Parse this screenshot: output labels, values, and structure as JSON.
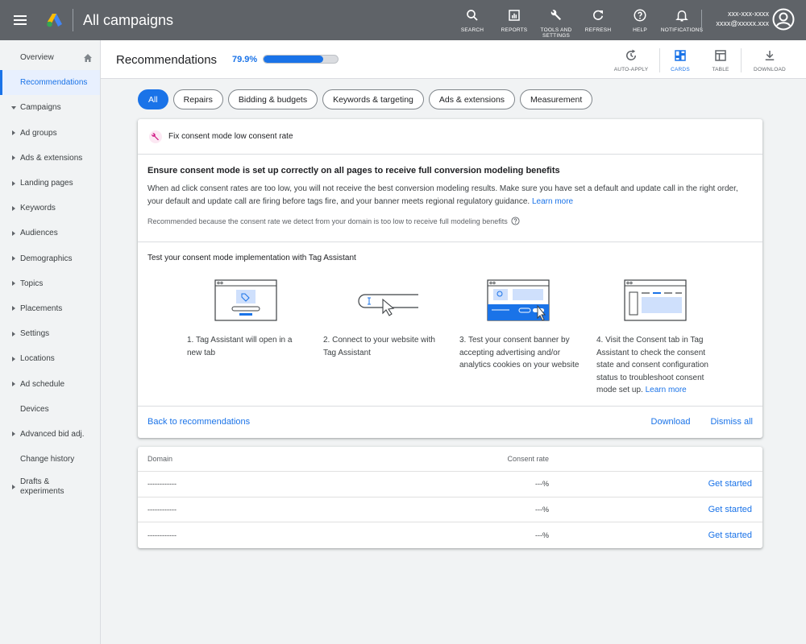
{
  "topbar": {
    "title": "All campaigns",
    "actions": [
      {
        "id": "search",
        "label": "SEARCH",
        "icon": "search-icon"
      },
      {
        "id": "reports",
        "label": "REPORTS",
        "icon": "reports-icon"
      },
      {
        "id": "tools",
        "label": "TOOLS AND SETTINGS",
        "icon": "wrench-icon"
      },
      {
        "id": "refresh",
        "label": "REFRESH",
        "icon": "refresh-icon"
      },
      {
        "id": "help",
        "label": "HELP",
        "icon": "help-icon"
      },
      {
        "id": "notifications",
        "label": "NOTIFICATIONS",
        "icon": "bell-icon"
      }
    ],
    "account_id": "xxx-xxx-xxxx",
    "account_email": "xxxx@xxxxx.xxx"
  },
  "sidebar": {
    "items": [
      {
        "label": "Overview",
        "caret": "none"
      },
      {
        "label": "Recommendations",
        "caret": "none",
        "active": true
      },
      {
        "label": "Campaigns",
        "caret": "down"
      },
      {
        "label": "Ad groups",
        "caret": "right"
      },
      {
        "label": "Ads & extensions",
        "caret": "right"
      },
      {
        "label": "Landing pages",
        "caret": "right"
      },
      {
        "label": "Keywords",
        "caret": "right"
      },
      {
        "label": "Audiences",
        "caret": "right"
      },
      {
        "label": "Demographics",
        "caret": "right"
      },
      {
        "label": "Topics",
        "caret": "right"
      },
      {
        "label": "Placements",
        "caret": "right"
      },
      {
        "label": "Settings",
        "caret": "right"
      },
      {
        "label": "Locations",
        "caret": "right"
      },
      {
        "label": "Ad schedule",
        "caret": "right"
      },
      {
        "label": "Devices",
        "caret": "none"
      },
      {
        "label": "Advanced bid adj.",
        "caret": "right"
      },
      {
        "label": "Change history",
        "caret": "none"
      },
      {
        "label": "Drafts & experiments",
        "caret": "right"
      }
    ]
  },
  "header": {
    "title": "Recommendations",
    "score": "79.9%",
    "score_value": 79.9,
    "tools": {
      "auto_apply": "AUTO-APPLY",
      "cards": "CARDS",
      "table": "TABLE",
      "download": "DOWNLOAD"
    }
  },
  "chips": [
    "All",
    "Repairs",
    "Bidding & budgets",
    "Keywords & targeting",
    "Ads & extensions",
    "Measurement"
  ],
  "card": {
    "title": "Fix consent mode low consent rate",
    "headline": "Ensure consent mode is set up correctly on all pages to receive full conversion modeling benefits",
    "description": "When ad click consent rates are too low, you will not receive the best conversion modeling results. Make sure you have set a default and update call in the right order, your default and update call are firing before tags fire, and your banner meets regional regulatory guidance.",
    "learn_more": "Learn more",
    "reason": "Recommended because the consent rate we detect from your domain is too low to receive full modeling benefits",
    "steps_title": "Test your consent mode implementation with Tag Assistant",
    "steps": [
      {
        "text": "1. Tag Assistant will open in a new tab"
      },
      {
        "text": "2. Connect to your website with Tag Assistant"
      },
      {
        "text": "3. Test your consent banner by accepting advertising and/or analytics cookies on your website"
      },
      {
        "text": "4. Visit the Consent tab in Tag Assistant to check the consent state and consent configuration status to troubleshoot consent mode set up.",
        "link": "Learn more"
      }
    ],
    "back": "Back to recommendations",
    "download": "Download",
    "dismiss": "Dismiss all"
  },
  "table": {
    "headers": {
      "domain": "Domain",
      "rate": "Consent rate"
    },
    "rows": [
      {
        "domain": "------------",
        "rate": "---%",
        "action": "Get started"
      },
      {
        "domain": "------------",
        "rate": "---%",
        "action": "Get started"
      },
      {
        "domain": "------------",
        "rate": "---%",
        "action": "Get started"
      }
    ]
  },
  "colors": {
    "topbar": "#5f6368",
    "accent": "#1a73e8"
  }
}
